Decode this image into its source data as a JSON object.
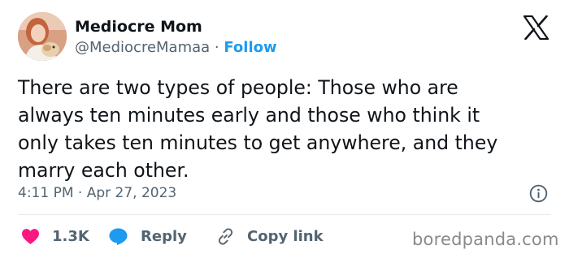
{
  "author": {
    "name": "Mediocre Mom",
    "handle": "@MediocreMamaa",
    "separator": " · ",
    "follow_label": "Follow",
    "avatar_icon": "profile-photo"
  },
  "platform_icon": "x-logo-icon",
  "tweet": {
    "text": "There are two types of people: Those who are\nalways ten minutes early and those who think it\nonly takes ten minutes to get anywhere, and they\nmarry each other.",
    "timestamp": "4:11 PM · Apr 27, 2023"
  },
  "actions": {
    "like_count": "1.3K",
    "reply_label": "Reply",
    "copy_label": "Copy link"
  },
  "watermark": "boredpanda.com",
  "colors": {
    "accent": "#1d9bf0",
    "like": "#f91880",
    "muted": "#536471",
    "text": "#0f1419"
  }
}
